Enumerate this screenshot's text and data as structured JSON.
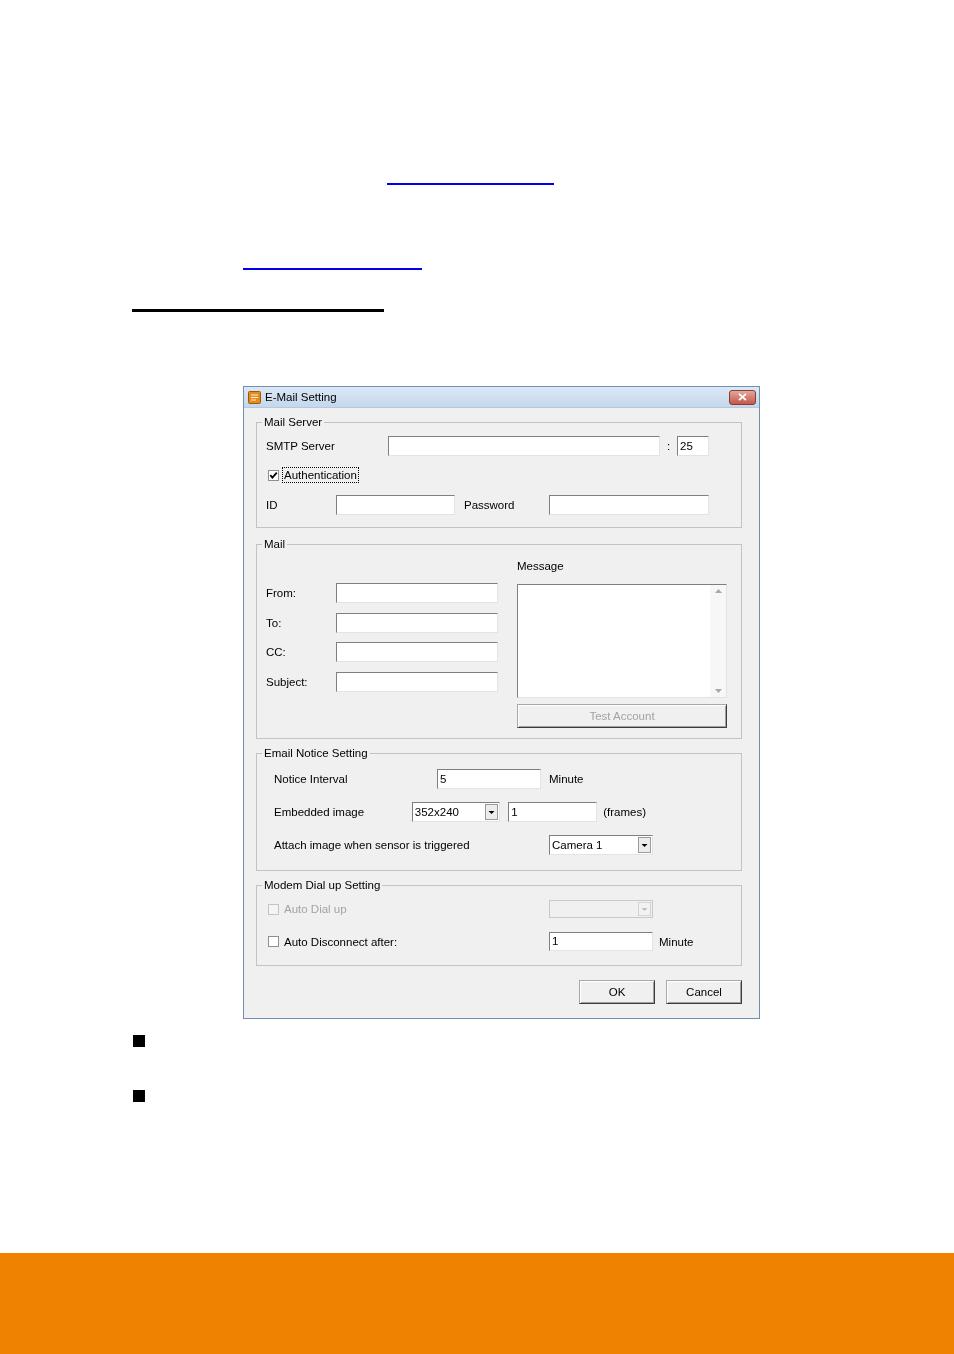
{
  "window": {
    "title": "E-Mail Setting"
  },
  "mail_server": {
    "legend": "Mail Server",
    "smtp_label": "SMTP Server",
    "port_separator": ":",
    "port": "25",
    "authentication": {
      "label": "Authentication",
      "checked": true,
      "focused": true
    },
    "id_label": "ID",
    "password_label": "Password"
  },
  "mail": {
    "legend": "Mail",
    "fields": [
      {
        "label": "From:"
      },
      {
        "label": "To:"
      },
      {
        "label": "CC:"
      },
      {
        "label": "Subject:"
      }
    ],
    "message_label": "Message",
    "test_button": {
      "label": "Test Account",
      "disabled": true
    }
  },
  "email_notice": {
    "legend": "Email Notice Setting",
    "interval_label": "Notice Interval",
    "interval": "5",
    "interval_unit": "Minute",
    "image_label": "Embedded image",
    "image_size": "352x240",
    "frames": "1",
    "frames_unit": "(frames)",
    "attach_label": "Attach image when sensor is triggered",
    "camera": "Camera 1"
  },
  "modem": {
    "legend": "Modem Dial up Setting",
    "auto_dial": {
      "label": "Auto Dial up",
      "checked": false,
      "disabled": true
    },
    "dial_device": {
      "disabled": true
    },
    "auto_disconnect": {
      "label": "Auto Disconnect after:",
      "checked": false,
      "disabled": false
    },
    "disconnect_after": "1",
    "disconnect_unit": "Minute"
  },
  "buttons": [
    {
      "label": "OK"
    },
    {
      "label": "Cancel"
    }
  ]
}
